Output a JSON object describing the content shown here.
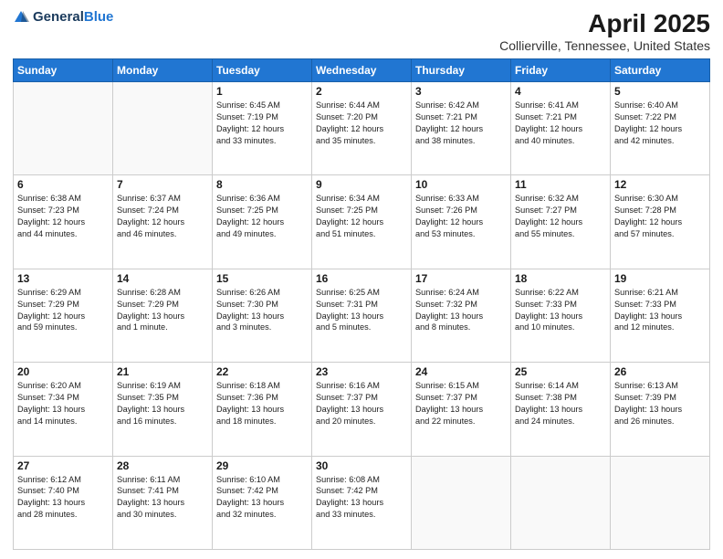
{
  "header": {
    "logo_general": "General",
    "logo_blue": "Blue",
    "title": "April 2025",
    "subtitle": "Collierville, Tennessee, United States"
  },
  "days": [
    "Sunday",
    "Monday",
    "Tuesday",
    "Wednesday",
    "Thursday",
    "Friday",
    "Saturday"
  ],
  "weeks": [
    [
      {
        "num": "",
        "info": ""
      },
      {
        "num": "",
        "info": ""
      },
      {
        "num": "1",
        "info": "Sunrise: 6:45 AM\nSunset: 7:19 PM\nDaylight: 12 hours\nand 33 minutes."
      },
      {
        "num": "2",
        "info": "Sunrise: 6:44 AM\nSunset: 7:20 PM\nDaylight: 12 hours\nand 35 minutes."
      },
      {
        "num": "3",
        "info": "Sunrise: 6:42 AM\nSunset: 7:21 PM\nDaylight: 12 hours\nand 38 minutes."
      },
      {
        "num": "4",
        "info": "Sunrise: 6:41 AM\nSunset: 7:21 PM\nDaylight: 12 hours\nand 40 minutes."
      },
      {
        "num": "5",
        "info": "Sunrise: 6:40 AM\nSunset: 7:22 PM\nDaylight: 12 hours\nand 42 minutes."
      }
    ],
    [
      {
        "num": "6",
        "info": "Sunrise: 6:38 AM\nSunset: 7:23 PM\nDaylight: 12 hours\nand 44 minutes."
      },
      {
        "num": "7",
        "info": "Sunrise: 6:37 AM\nSunset: 7:24 PM\nDaylight: 12 hours\nand 46 minutes."
      },
      {
        "num": "8",
        "info": "Sunrise: 6:36 AM\nSunset: 7:25 PM\nDaylight: 12 hours\nand 49 minutes."
      },
      {
        "num": "9",
        "info": "Sunrise: 6:34 AM\nSunset: 7:25 PM\nDaylight: 12 hours\nand 51 minutes."
      },
      {
        "num": "10",
        "info": "Sunrise: 6:33 AM\nSunset: 7:26 PM\nDaylight: 12 hours\nand 53 minutes."
      },
      {
        "num": "11",
        "info": "Sunrise: 6:32 AM\nSunset: 7:27 PM\nDaylight: 12 hours\nand 55 minutes."
      },
      {
        "num": "12",
        "info": "Sunrise: 6:30 AM\nSunset: 7:28 PM\nDaylight: 12 hours\nand 57 minutes."
      }
    ],
    [
      {
        "num": "13",
        "info": "Sunrise: 6:29 AM\nSunset: 7:29 PM\nDaylight: 12 hours\nand 59 minutes."
      },
      {
        "num": "14",
        "info": "Sunrise: 6:28 AM\nSunset: 7:29 PM\nDaylight: 13 hours\nand 1 minute."
      },
      {
        "num": "15",
        "info": "Sunrise: 6:26 AM\nSunset: 7:30 PM\nDaylight: 13 hours\nand 3 minutes."
      },
      {
        "num": "16",
        "info": "Sunrise: 6:25 AM\nSunset: 7:31 PM\nDaylight: 13 hours\nand 5 minutes."
      },
      {
        "num": "17",
        "info": "Sunrise: 6:24 AM\nSunset: 7:32 PM\nDaylight: 13 hours\nand 8 minutes."
      },
      {
        "num": "18",
        "info": "Sunrise: 6:22 AM\nSunset: 7:33 PM\nDaylight: 13 hours\nand 10 minutes."
      },
      {
        "num": "19",
        "info": "Sunrise: 6:21 AM\nSunset: 7:33 PM\nDaylight: 13 hours\nand 12 minutes."
      }
    ],
    [
      {
        "num": "20",
        "info": "Sunrise: 6:20 AM\nSunset: 7:34 PM\nDaylight: 13 hours\nand 14 minutes."
      },
      {
        "num": "21",
        "info": "Sunrise: 6:19 AM\nSunset: 7:35 PM\nDaylight: 13 hours\nand 16 minutes."
      },
      {
        "num": "22",
        "info": "Sunrise: 6:18 AM\nSunset: 7:36 PM\nDaylight: 13 hours\nand 18 minutes."
      },
      {
        "num": "23",
        "info": "Sunrise: 6:16 AM\nSunset: 7:37 PM\nDaylight: 13 hours\nand 20 minutes."
      },
      {
        "num": "24",
        "info": "Sunrise: 6:15 AM\nSunset: 7:37 PM\nDaylight: 13 hours\nand 22 minutes."
      },
      {
        "num": "25",
        "info": "Sunrise: 6:14 AM\nSunset: 7:38 PM\nDaylight: 13 hours\nand 24 minutes."
      },
      {
        "num": "26",
        "info": "Sunrise: 6:13 AM\nSunset: 7:39 PM\nDaylight: 13 hours\nand 26 minutes."
      }
    ],
    [
      {
        "num": "27",
        "info": "Sunrise: 6:12 AM\nSunset: 7:40 PM\nDaylight: 13 hours\nand 28 minutes."
      },
      {
        "num": "28",
        "info": "Sunrise: 6:11 AM\nSunset: 7:41 PM\nDaylight: 13 hours\nand 30 minutes."
      },
      {
        "num": "29",
        "info": "Sunrise: 6:10 AM\nSunset: 7:42 PM\nDaylight: 13 hours\nand 32 minutes."
      },
      {
        "num": "30",
        "info": "Sunrise: 6:08 AM\nSunset: 7:42 PM\nDaylight: 13 hours\nand 33 minutes."
      },
      {
        "num": "",
        "info": ""
      },
      {
        "num": "",
        "info": ""
      },
      {
        "num": "",
        "info": ""
      }
    ]
  ]
}
